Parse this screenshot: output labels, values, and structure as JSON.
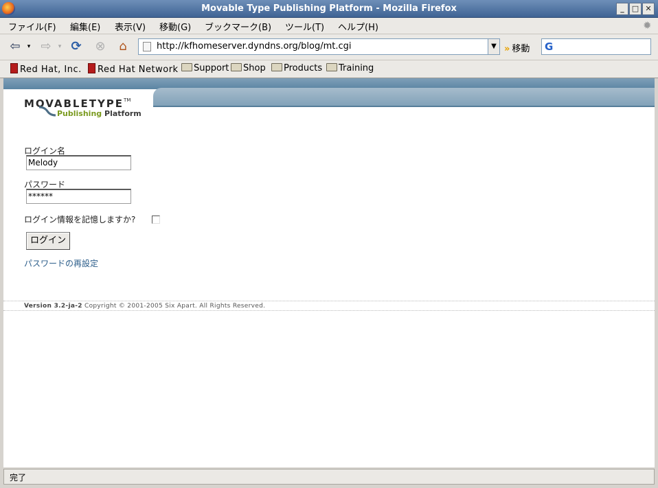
{
  "window": {
    "title": "Movable Type Publishing Platform - Mozilla Firefox"
  },
  "menu": {
    "items": [
      "ファイル(F)",
      "編集(E)",
      "表示(V)",
      "移動(G)",
      "ブックマーク(B)",
      "ツール(T)",
      "ヘルプ(H)"
    ]
  },
  "navigation": {
    "url": "http://kfhomeserver.dyndns.org/blog/mt.cgi",
    "go_label": "移動"
  },
  "bookmarks": {
    "items": [
      "Red Hat, Inc.",
      "Red Hat Network",
      "Support",
      "Shop",
      "Products",
      "Training"
    ]
  },
  "page": {
    "logo_main": "MOVABLETYPE",
    "logo_tm": "TM",
    "logo_sub_publishing": "Publishing",
    "logo_sub_platform": "Platform",
    "username_label": "ログイン名",
    "username_value": "Melody",
    "password_label": "パスワード",
    "password_value": "******",
    "remember_label": "ログイン情報を記憶しますか?",
    "login_button": "ログイン",
    "reset_link": "パスワードの再設定",
    "version": "Version 3.2-ja-2",
    "copyright": "Copyright © 2001-2005 Six Apart. All Rights Reserved."
  },
  "status": {
    "text": "完了"
  },
  "colors": {
    "title_bar": "#3f6394",
    "mt_header": "#7fa0b7",
    "link": "#2b5d8a",
    "logo_green": "#7a9a1e"
  }
}
